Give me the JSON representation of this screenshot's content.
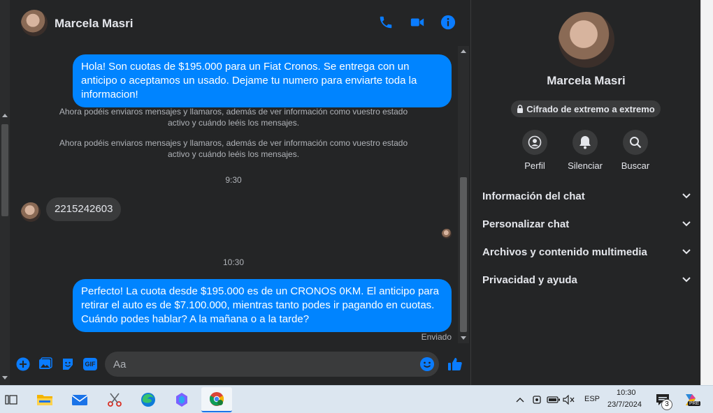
{
  "contact": {
    "name": "Marcela Masri"
  },
  "header": {
    "call_label": "phone-icon",
    "video_label": "video-icon",
    "info_label": "info-icon"
  },
  "messages": {
    "out1": "Hola! Son cuotas de $195.000 para un Fiat Cronos. Se entrega con un anticipo o aceptamos un usado. Dejame tu numero para enviarte toda la informacion!",
    "note1": "Ahora podéis enviaros mensajes y llamaros, además de ver información como vuestro estado activo y cuándo leéis los mensajes.",
    "note2": "Ahora podéis enviaros mensajes y llamaros, además de ver información como vuestro estado activo y cuándo leéis los mensajes.",
    "time1": "9:30",
    "in1": "2215242603",
    "time2": "10:30",
    "out2": "Perfecto! La cuota desde $195.000 es de un CRONOS 0KM. El anticipo para retirar el auto es de $7.100.000, mientras tanto podes ir pagando en cuotas. Cuándo podes hablar? A la mañana o a la tarde?",
    "status": "Enviado"
  },
  "composer": {
    "placeholder": "Aa",
    "gif_label": "GIF"
  },
  "info": {
    "name": "Marcela Masri",
    "encryption": "Cifrado de extremo a extremo",
    "actions": [
      "Perfil",
      "Silenciar",
      "Buscar"
    ],
    "sections": [
      "Información del chat",
      "Personalizar chat",
      "Archivos y contenido multimedia",
      "Privacidad y ayuda"
    ]
  },
  "taskbar": {
    "lang": "ESP",
    "time": "10:30",
    "date": "23/7/2024",
    "notif_count": "3",
    "copilot_badge": "PRE"
  },
  "colors": {
    "accent": "#0084ff",
    "bg": "#242526",
    "bubble_in": "#3a3b3c"
  }
}
